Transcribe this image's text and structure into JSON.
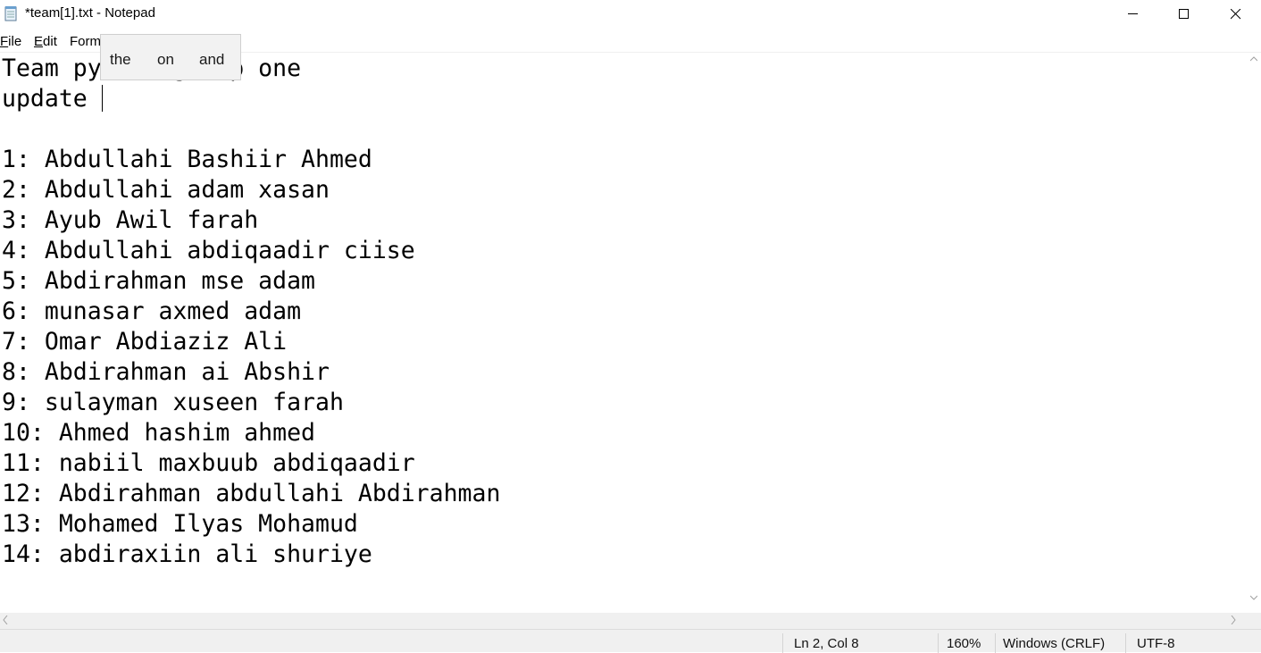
{
  "window": {
    "title": "*team[1].txt - Notepad",
    "app_icon": "notepad-icon"
  },
  "menu": {
    "file_first": "F",
    "file_rest": "ile",
    "edit_first": "E",
    "edit_rest": "dit",
    "format_label": "Form"
  },
  "suggestions": [
    "the",
    "on",
    "and"
  ],
  "editor": {
    "lines": [
      "Team python group one",
      "update ",
      "",
      "1: Abdullahi Bashiir Ahmed",
      "2: Abdullahi adam xasan",
      "3: Ayub Awil farah",
      "4: Abdullahi abdiqaadir ciise",
      "5: Abdirahman mse adam",
      "6: munasar axmed adam",
      "7: Omar Abdiaziz Ali",
      "8: Abdirahman ai Abshir",
      "9: sulayman xuseen farah",
      "10: Ahmed hashim ahmed",
      "11: nabiil maxbuub abdiqaadir",
      "12: Abdirahman abdullahi Abdirahman",
      "13: Mohamed Ilyas Mohamud",
      "14: abdiraxiin ali shuriye"
    ]
  },
  "status": {
    "position": "Ln 2, Col 8",
    "zoom": "160%",
    "line_ending": "Windows (CRLF)",
    "encoding": "UTF-8"
  }
}
